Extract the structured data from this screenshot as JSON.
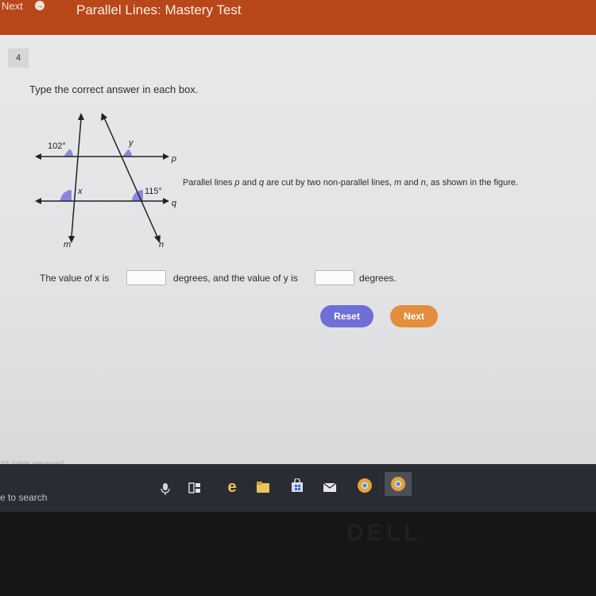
{
  "header": {
    "next_label": "Next",
    "title": "Parallel Lines: Mastery Test"
  },
  "question": {
    "number": "4",
    "instruction": "Type the correct answer in each box.",
    "statement": {
      "part1": "Parallel lines ",
      "p": "p",
      "part2": " and ",
      "q": "q",
      "part3": " are cut by two non-parallel lines, ",
      "m": "m",
      "part4": " and ",
      "n": "n",
      "part5": ", as shown in the figure."
    },
    "figure": {
      "angle_102": "102°",
      "angle_115": "115°",
      "label_y": "y",
      "label_x": "x",
      "label_p": "p",
      "label_q": "q",
      "label_m": "m",
      "label_n": "n",
      "arc_color": "#8a86e0"
    },
    "answer": {
      "prefix": "The value of x is",
      "middle": "degrees, and the value of y is",
      "suffix": "degrees.",
      "x_value": "",
      "y_value": ""
    }
  },
  "buttons": {
    "reset": "Reset",
    "next": "Next"
  },
  "footer": {
    "rights": "All rights reserved."
  },
  "taskbar": {
    "search": "e to search",
    "icons": [
      "microphone-icon",
      "task-view-icon",
      "edge-icon",
      "file-explorer-icon",
      "store-icon",
      "mail-icon",
      "chrome-icon",
      "chrome-active-icon"
    ]
  },
  "colors": {
    "header_bg": "#b8471a",
    "reset_btn": "#6f6fd7",
    "next_btn": "#e48d3c"
  }
}
